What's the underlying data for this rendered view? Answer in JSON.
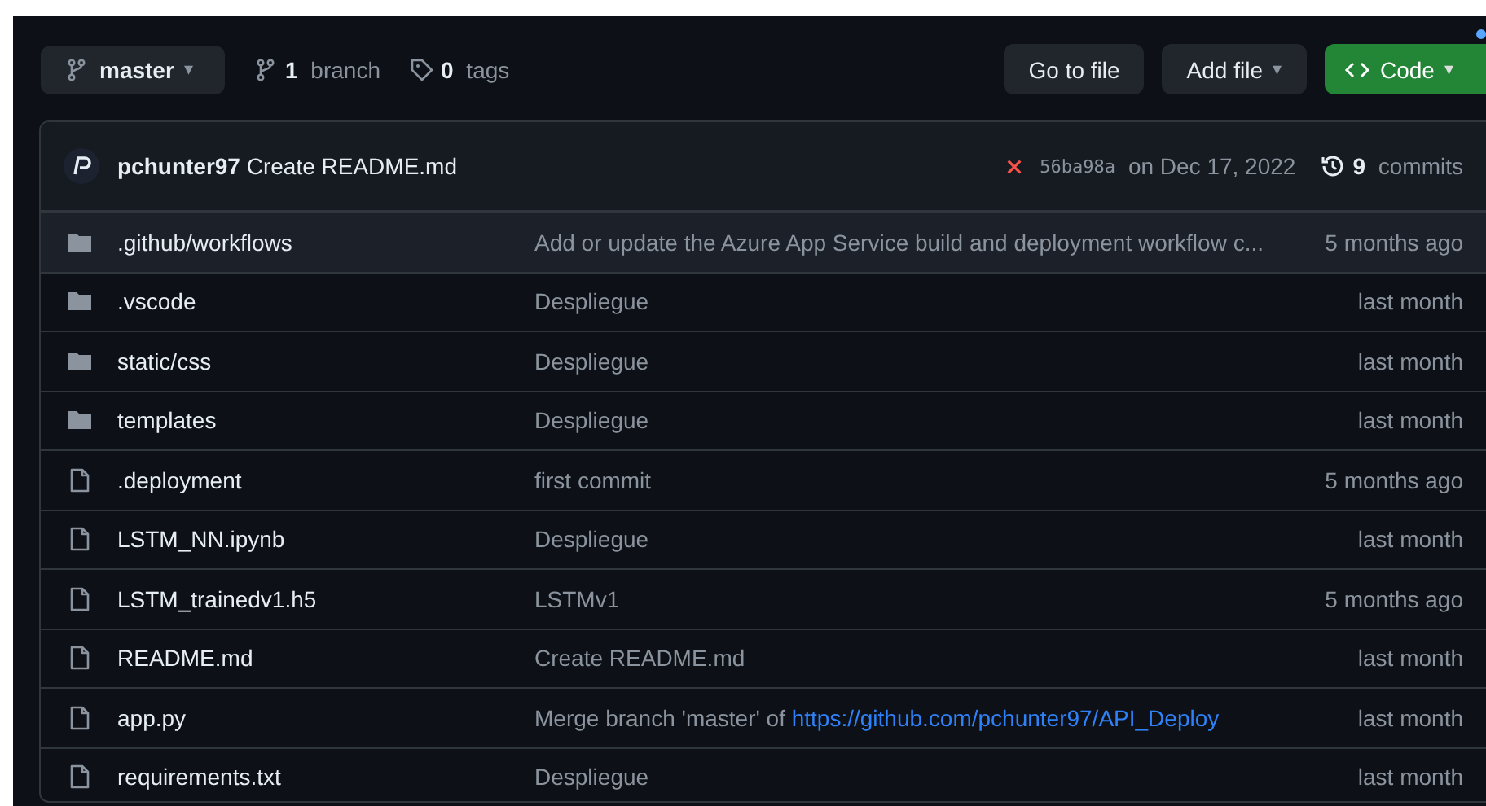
{
  "toolbar": {
    "branch": "master",
    "branch_caret": "▾",
    "branch_count": "1",
    "branch_label": "branch",
    "tag_count": "0",
    "tag_label": "tags",
    "buttons": [
      {
        "label": "Go to file",
        "kind": "plain"
      },
      {
        "label": "Add file",
        "kind": "dropdown",
        "caret": "▾"
      },
      {
        "label": "Code",
        "kind": "code",
        "caret": "▾"
      }
    ]
  },
  "commit": {
    "author": "pchunter97",
    "message": "Create README.md",
    "failed": true,
    "sha": "56ba98a",
    "date": "on Dec 17, 2022",
    "commit_count": "9",
    "commit_label": "commits"
  },
  "files": [
    {
      "kind": "folder",
      "name": ".github/workflows",
      "message": "Add or update the Azure App Service build and deployment workflow c...",
      "age": "5 months ago",
      "highlighted": true
    },
    {
      "kind": "folder",
      "name": ".vscode",
      "message": "Despliegue",
      "age": "last month",
      "highlighted": false
    },
    {
      "kind": "folder",
      "name": "static/css",
      "message": "Despliegue",
      "age": "last month",
      "highlighted": false
    },
    {
      "kind": "folder",
      "name": "templates",
      "message": "Despliegue",
      "age": "last month",
      "highlighted": false
    },
    {
      "kind": "file",
      "name": ".deployment",
      "message": "first commit",
      "age": "5 months ago",
      "highlighted": false
    },
    {
      "kind": "file",
      "name": "LSTM_NN.ipynb",
      "message": "Despliegue",
      "age": "last month",
      "highlighted": false
    },
    {
      "kind": "file",
      "name": "LSTM_trainedv1.h5",
      "message": "LSTMv1",
      "age": "5 months ago",
      "highlighted": false
    },
    {
      "kind": "file",
      "name": "README.md",
      "message": "Create README.md",
      "age": "last month",
      "highlighted": false
    },
    {
      "kind": "file",
      "name": "app.py",
      "message": "Merge branch 'master' of ",
      "link": "https://github.com/pchunter97/API_Deploy",
      "age": "last month",
      "highlighted": false
    },
    {
      "kind": "file",
      "name": "requirements.txt",
      "message": "Despliegue",
      "age": "last month",
      "highlighted": false
    }
  ]
}
